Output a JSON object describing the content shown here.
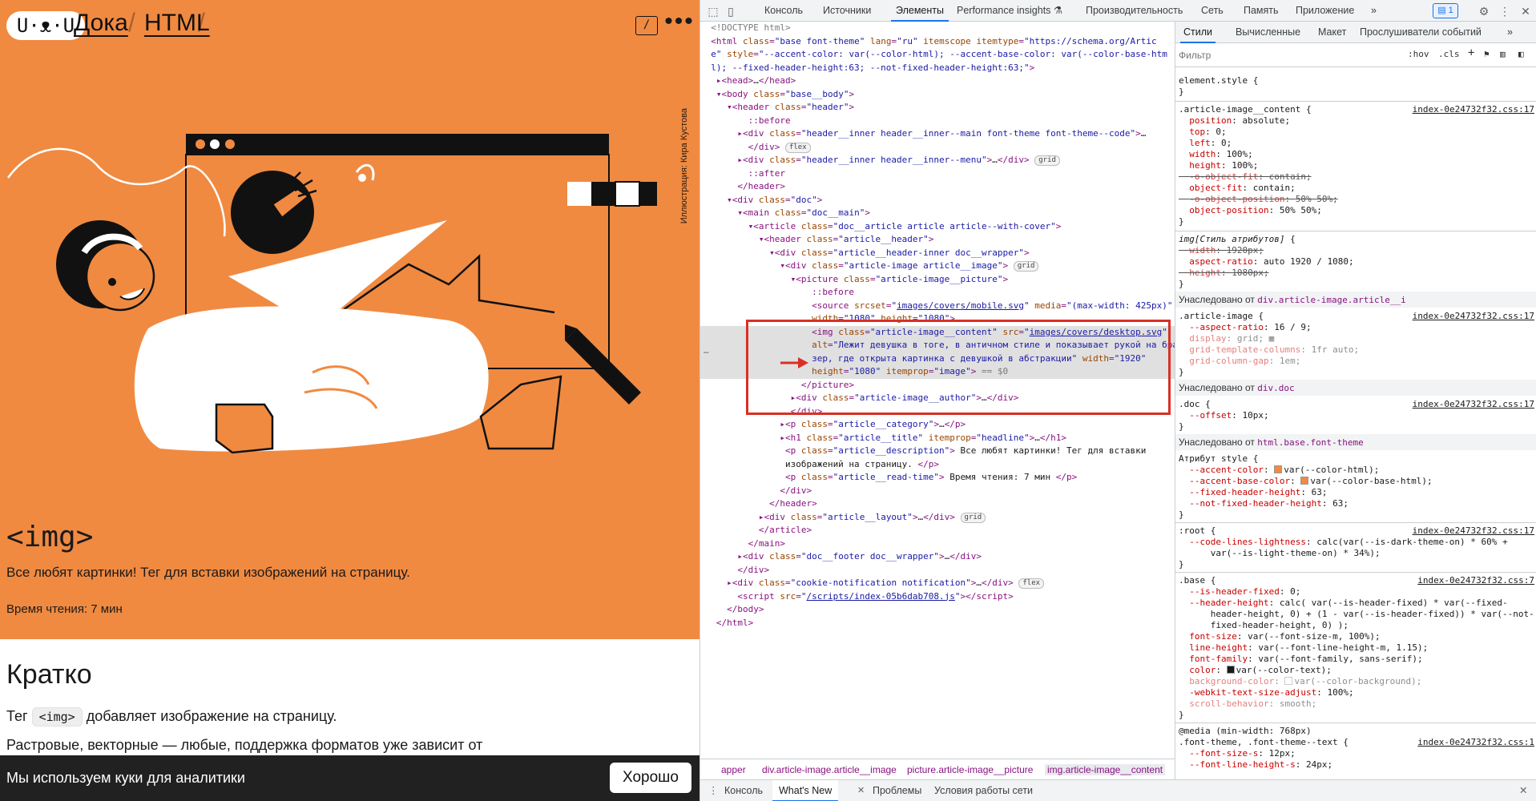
{
  "page": {
    "logo_text": "U·ᴥ·U",
    "breadcrumb": [
      "Дока",
      "HTML"
    ],
    "theme_toggle": "/",
    "menu_dots": "•••",
    "illustration_credit": "Иллюстрация: Кира Кустова",
    "hero_title": "<img>",
    "hero_description": "Все любят картинки! Тег для вставки изображений на страницу.",
    "read_time": "Время чтения: 7 мин",
    "section_title": "Кратко",
    "para1_before": "Тег ",
    "para1_code": "<img>",
    "para1_after": " добавляет изображение на страницу.",
    "para2": "Растровые, векторные — любые, поддержка форматов уже зависит от",
    "cookie_text": "Мы используем куки для аналитики",
    "cookie_button": "Хорошо",
    "colors": {
      "hero_bg": "#f08a41",
      "cookie_bg": "#212121"
    }
  },
  "devtools": {
    "tabs": [
      "Консоль",
      "Источники",
      "Элементы",
      "Performance insights ⚗",
      "Производительность",
      "Сеть",
      "Память",
      "Приложение",
      "»"
    ],
    "active_tab": "Элементы",
    "issues_badge": "▤ 1",
    "styles_tabs": [
      "Стили",
      "Вычисленные",
      "Макет",
      "Прослушиватели событий",
      "»"
    ],
    "filter_placeholder": "Фильтр",
    "filter_buttons": [
      ":hov",
      ".cls",
      "+"
    ],
    "breadcrumb": [
      "apper",
      "div.article-image.article__image",
      "picture.article-image__picture",
      "img.article-image__content"
    ],
    "drawer_tabs": [
      "Консоль",
      "What's New",
      "Проблемы",
      "Условия работы сети"
    ],
    "drawer_active": "What's New",
    "drawer_close": "✕"
  }
}
